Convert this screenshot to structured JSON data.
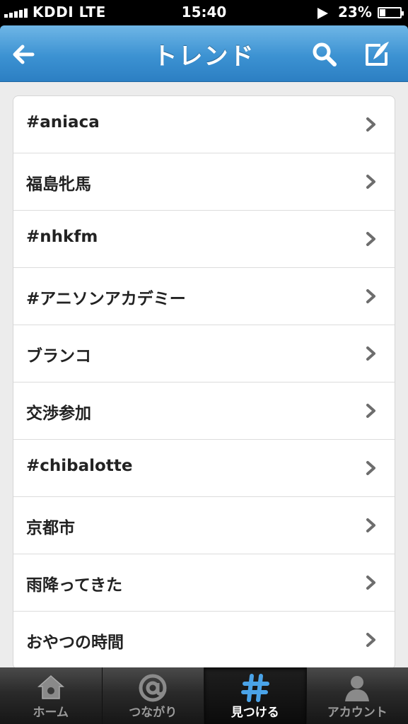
{
  "status_bar": {
    "carrier": "KDDI  LTE",
    "time": "15:40",
    "battery": "23%",
    "battery_level": 0.23
  },
  "nav": {
    "title": "トレンド",
    "back_icon": "arrow-left-icon",
    "search_icon": "search-icon",
    "compose_icon": "compose-icon"
  },
  "trends": [
    {
      "label": "#aniaca"
    },
    {
      "label": "福島牝馬"
    },
    {
      "label": "#nhkfm"
    },
    {
      "label": "#アニソンアカデミー"
    },
    {
      "label": "ブランコ"
    },
    {
      "label": "交渉参加"
    },
    {
      "label": "#chibalotte"
    },
    {
      "label": "京都市"
    },
    {
      "label": "雨降ってきた"
    },
    {
      "label": "おやつの時間"
    }
  ],
  "tabs": [
    {
      "label": "ホーム",
      "icon": "home-icon",
      "active": false
    },
    {
      "label": "つながり",
      "icon": "at-icon",
      "active": false
    },
    {
      "label": "見つける",
      "icon": "hashtag-icon",
      "active": true
    },
    {
      "label": "アカウント",
      "icon": "person-icon",
      "active": false
    }
  ],
  "colors": {
    "nav_blue": "#3c92d2",
    "active_tab_icon": "#4aa3e8",
    "inactive_tab": "#9a9a9a"
  }
}
